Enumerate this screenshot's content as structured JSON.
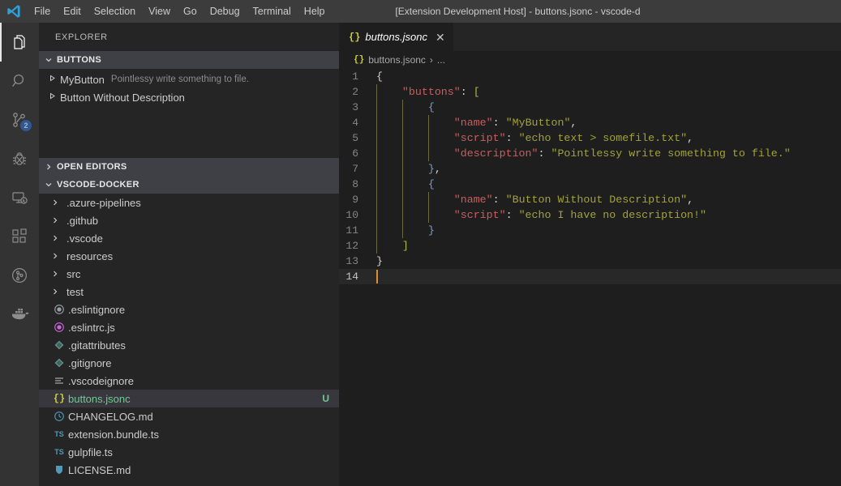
{
  "titlebar": {
    "logo_icon": "vscode-logo-icon",
    "window_title": "[Extension Development Host] - buttons.jsonc - vscode-d",
    "menu": [
      {
        "label": "File"
      },
      {
        "label": "Edit"
      },
      {
        "label": "Selection"
      },
      {
        "label": "View"
      },
      {
        "label": "Go"
      },
      {
        "label": "Debug"
      },
      {
        "label": "Terminal"
      },
      {
        "label": "Help"
      }
    ]
  },
  "activitybar": {
    "items": [
      {
        "name": "explorer",
        "icon": "files-icon",
        "active": true,
        "badge": ""
      },
      {
        "name": "search",
        "icon": "search-icon",
        "active": false,
        "badge": ""
      },
      {
        "name": "source-control",
        "icon": "source-control-icon",
        "active": false,
        "badge": "2"
      },
      {
        "name": "debug",
        "icon": "bug-icon",
        "active": false,
        "badge": ""
      },
      {
        "name": "remote-explorer",
        "icon": "remote-screen-icon",
        "active": false,
        "badge": ""
      },
      {
        "name": "extensions",
        "icon": "extensions-blocks-icon",
        "active": false,
        "badge": ""
      },
      {
        "name": "gitlens",
        "icon": "gitlens-circle-icon",
        "active": false,
        "badge": ""
      },
      {
        "name": "docker",
        "icon": "docker-whale-icon",
        "active": false,
        "badge": ""
      }
    ]
  },
  "sidebar": {
    "title": "EXPLORER",
    "buttons_pane": {
      "header": "BUTTONS",
      "expanded": true,
      "items": [
        {
          "name": "MyButton",
          "description": "Pointlessy write something to file."
        },
        {
          "name": "Button Without Description",
          "description": ""
        }
      ]
    },
    "open_editors_pane": {
      "header": "OPEN EDITORS",
      "expanded": false
    },
    "workspace_pane": {
      "header": "VSCODE-DOCKER",
      "expanded": true,
      "entries": [
        {
          "label": ".azure-pipelines",
          "kind": "folder",
          "icon": "chevron-right-icon",
          "selected": false,
          "git": ""
        },
        {
          "label": ".github",
          "kind": "folder",
          "icon": "chevron-right-icon",
          "selected": false,
          "git": ""
        },
        {
          "label": ".vscode",
          "kind": "folder",
          "icon": "chevron-right-icon",
          "selected": false,
          "git": ""
        },
        {
          "label": "resources",
          "kind": "folder",
          "icon": "chevron-right-icon",
          "selected": false,
          "git": ""
        },
        {
          "label": "src",
          "kind": "folder",
          "icon": "chevron-right-icon",
          "selected": false,
          "git": ""
        },
        {
          "label": "test",
          "kind": "folder",
          "icon": "chevron-right-icon",
          "selected": false,
          "git": ""
        },
        {
          "label": ".eslintignore",
          "kind": "file",
          "icon": "eslint-icon",
          "icon_color": "#9aa0a6",
          "selected": false,
          "git": ""
        },
        {
          "label": ".eslintrc.js",
          "kind": "file",
          "icon": "eslint-icon",
          "icon_color": "#cf64d8",
          "selected": false,
          "git": ""
        },
        {
          "label": ".gitattributes",
          "kind": "file",
          "icon": "git-diamond-icon",
          "icon_color": "#6aa9a0",
          "selected": false,
          "git": ""
        },
        {
          "label": ".gitignore",
          "kind": "file",
          "icon": "git-diamond-icon",
          "icon_color": "#6aa9a0",
          "selected": false,
          "git": ""
        },
        {
          "label": ".vscodeignore",
          "kind": "file",
          "icon": "lines-icon",
          "icon_color": "#c5c5c5",
          "selected": false,
          "git": ""
        },
        {
          "label": "buttons.jsonc",
          "kind": "file",
          "icon": "json-braces-icon",
          "icon_color": "#cbcb41",
          "selected": true,
          "git": "U",
          "text_color": "#73c991"
        },
        {
          "label": "CHANGELOG.md",
          "kind": "file",
          "icon": "clock-icon",
          "icon_color": "#519aba",
          "selected": false,
          "git": ""
        },
        {
          "label": "extension.bundle.ts",
          "kind": "file",
          "icon": "typescript-icon",
          "icon_color": "#519aba",
          "selected": false,
          "git": ""
        },
        {
          "label": "gulpfile.ts",
          "kind": "file",
          "icon": "typescript-icon",
          "icon_color": "#519aba",
          "selected": false,
          "git": ""
        },
        {
          "label": "LICENSE.md",
          "kind": "file",
          "icon": "license-shield-icon",
          "icon_color": "#519aba",
          "selected": false,
          "git": ""
        }
      ]
    }
  },
  "editor": {
    "tab": {
      "icon": "json-braces-icon",
      "label": "buttons.jsonc",
      "close_icon": "close-icon",
      "preview": true
    },
    "breadcrumb": {
      "icon": "json-braces-icon",
      "file": "buttons.jsonc",
      "separator": "›",
      "tail": "..."
    },
    "language": "jsonc",
    "cursor_line": 14,
    "lines": [
      {
        "n": 1,
        "tokens": [
          {
            "t": "{",
            "c": "b1"
          }
        ],
        "indent": 0
      },
      {
        "n": 2,
        "tokens": [
          {
            "t": "    ",
            "c": "punct"
          },
          {
            "t": "\"buttons\"",
            "c": "key"
          },
          {
            "t": ": ",
            "c": "punct"
          },
          {
            "t": "[",
            "c": "b2"
          }
        ],
        "indent": 1
      },
      {
        "n": 3,
        "tokens": [
          {
            "t": "        ",
            "c": "punct"
          },
          {
            "t": "{",
            "c": "b3"
          }
        ],
        "indent": 2
      },
      {
        "n": 4,
        "tokens": [
          {
            "t": "            ",
            "c": "punct"
          },
          {
            "t": "\"name\"",
            "c": "key"
          },
          {
            "t": ": ",
            "c": "punct"
          },
          {
            "t": "\"MyButton\"",
            "c": "str"
          },
          {
            "t": ",",
            "c": "punct"
          }
        ],
        "indent": 3
      },
      {
        "n": 5,
        "tokens": [
          {
            "t": "            ",
            "c": "punct"
          },
          {
            "t": "\"script\"",
            "c": "key"
          },
          {
            "t": ": ",
            "c": "punct"
          },
          {
            "t": "\"echo text > somefile.txt\"",
            "c": "str"
          },
          {
            "t": ",",
            "c": "punct"
          }
        ],
        "indent": 3
      },
      {
        "n": 6,
        "tokens": [
          {
            "t": "            ",
            "c": "punct"
          },
          {
            "t": "\"description\"",
            "c": "key"
          },
          {
            "t": ": ",
            "c": "punct"
          },
          {
            "t": "\"Pointlessy write something to file.\"",
            "c": "str"
          }
        ],
        "indent": 3
      },
      {
        "n": 7,
        "tokens": [
          {
            "t": "        ",
            "c": "punct"
          },
          {
            "t": "}",
            "c": "b3"
          },
          {
            "t": ",",
            "c": "punct"
          }
        ],
        "indent": 2
      },
      {
        "n": 8,
        "tokens": [
          {
            "t": "        ",
            "c": "punct"
          },
          {
            "t": "{",
            "c": "b3"
          }
        ],
        "indent": 2
      },
      {
        "n": 9,
        "tokens": [
          {
            "t": "            ",
            "c": "punct"
          },
          {
            "t": "\"name\"",
            "c": "key"
          },
          {
            "t": ": ",
            "c": "punct"
          },
          {
            "t": "\"Button Without Description\"",
            "c": "str"
          },
          {
            "t": ",",
            "c": "punct"
          }
        ],
        "indent": 3
      },
      {
        "n": 10,
        "tokens": [
          {
            "t": "            ",
            "c": "punct"
          },
          {
            "t": "\"script\"",
            "c": "key"
          },
          {
            "t": ": ",
            "c": "punct"
          },
          {
            "t": "\"echo I have no description!\"",
            "c": "str"
          }
        ],
        "indent": 3
      },
      {
        "n": 11,
        "tokens": [
          {
            "t": "        ",
            "c": "punct"
          },
          {
            "t": "}",
            "c": "b3"
          }
        ],
        "indent": 2
      },
      {
        "n": 12,
        "tokens": [
          {
            "t": "    ",
            "c": "punct"
          },
          {
            "t": "]",
            "c": "b2"
          }
        ],
        "indent": 1
      },
      {
        "n": 13,
        "tokens": [
          {
            "t": "}",
            "c": "b1"
          }
        ],
        "indent": 0
      },
      {
        "n": 14,
        "tokens": [],
        "indent": 0
      }
    ]
  },
  "colors": {
    "titlebar_bg": "#3c3c3c",
    "activitybar_bg": "#333333",
    "sidebar_bg": "#252526",
    "editor_bg": "#1e1e1e",
    "selection_bg": "#37373d",
    "pane_header_bg": "#3f3f46",
    "badge_bg": "#2f6fd0",
    "cursor": "#e08c27",
    "key_color": "#cd5c5c",
    "string_color": "#a3a333",
    "untracked_green": "#73c991"
  }
}
